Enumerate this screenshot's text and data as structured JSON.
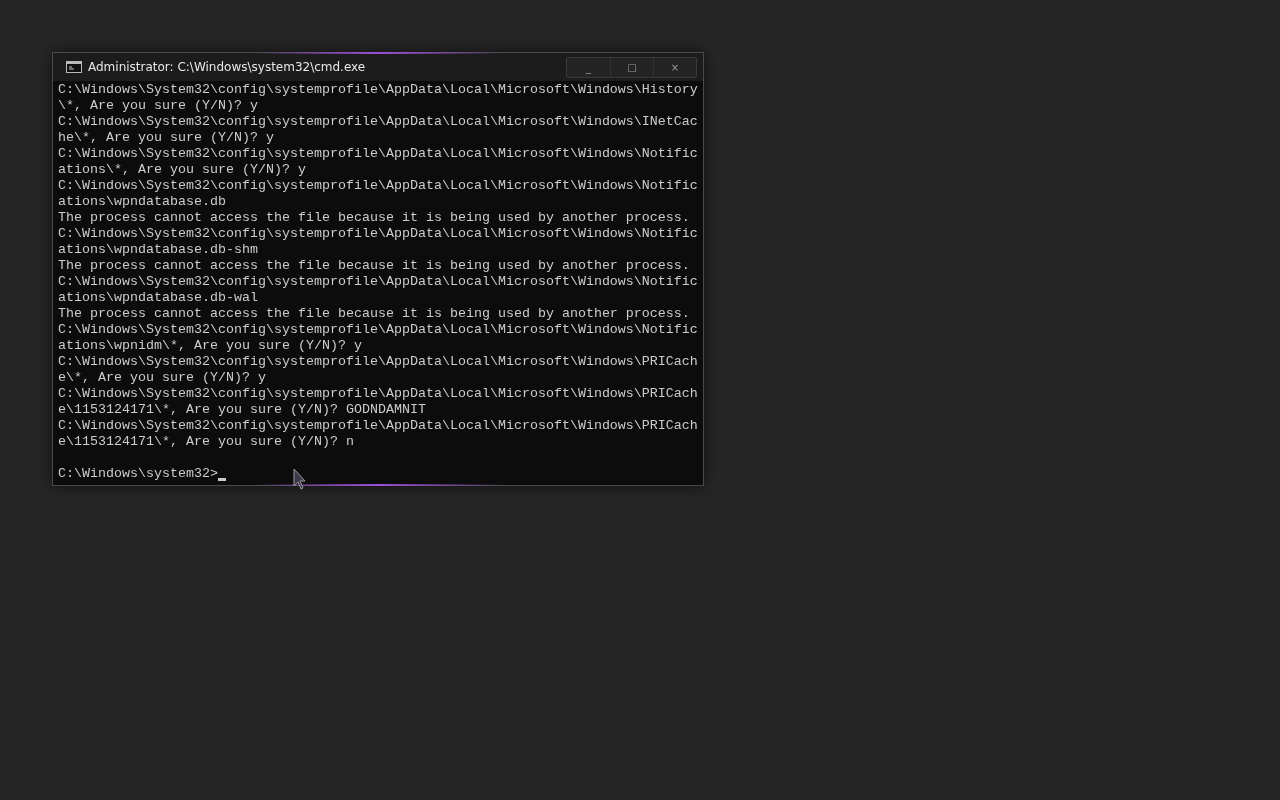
{
  "window": {
    "title": "Administrator: C:\\Windows\\system32\\cmd.exe",
    "buttons": [
      "_",
      "□",
      "×"
    ]
  },
  "console": {
    "lines": [
      "C:\\Windows\\System32\\config\\systemprofile\\AppData\\Local\\Microsoft\\Windows\\History",
      "\\*, Are you sure (Y/N)? y",
      "C:\\Windows\\System32\\config\\systemprofile\\AppData\\Local\\Microsoft\\Windows\\INetCac",
      "he\\*, Are you sure (Y/N)? y",
      "C:\\Windows\\System32\\config\\systemprofile\\AppData\\Local\\Microsoft\\Windows\\Notific",
      "ations\\*, Are you sure (Y/N)? y",
      "C:\\Windows\\System32\\config\\systemprofile\\AppData\\Local\\Microsoft\\Windows\\Notific",
      "ations\\wpndatabase.db",
      "The process cannot access the file because it is being used by another process.",
      "C:\\Windows\\System32\\config\\systemprofile\\AppData\\Local\\Microsoft\\Windows\\Notific",
      "ations\\wpndatabase.db-shm",
      "The process cannot access the file because it is being used by another process.",
      "C:\\Windows\\System32\\config\\systemprofile\\AppData\\Local\\Microsoft\\Windows\\Notific",
      "ations\\wpndatabase.db-wal",
      "The process cannot access the file because it is being used by another process.",
      "C:\\Windows\\System32\\config\\systemprofile\\AppData\\Local\\Microsoft\\Windows\\Notific",
      "ations\\wpnidm\\*, Are you sure (Y/N)? y",
      "C:\\Windows\\System32\\config\\systemprofile\\AppData\\Local\\Microsoft\\Windows\\PRICach",
      "e\\*, Are you sure (Y/N)? y",
      "C:\\Windows\\System32\\config\\systemprofile\\AppData\\Local\\Microsoft\\Windows\\PRICach",
      "e\\1153124171\\*, Are you sure (Y/N)? GODNDAMNIT",
      "C:\\Windows\\System32\\config\\systemprofile\\AppData\\Local\\Microsoft\\Windows\\PRICach",
      "e\\1153124171\\*, Are you sure (Y/N)? n"
    ],
    "prompt": {
      "text": "C:\\Windows\\system32>",
      "cursor": true
    }
  }
}
